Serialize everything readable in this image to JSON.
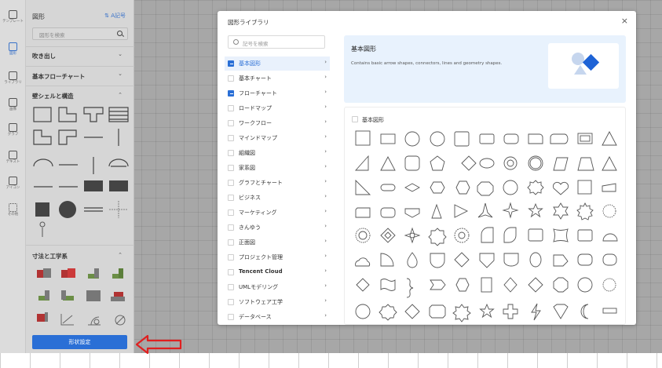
{
  "rail": {
    "items": [
      {
        "label": "テンプレート",
        "icon": "template-icon"
      },
      {
        "label": "図形",
        "icon": "shape-icon"
      },
      {
        "label": "ライブラリ",
        "icon": "library-icon"
      },
      {
        "label": "画像",
        "icon": "image-icon"
      },
      {
        "label": "グラフ",
        "icon": "chart-icon"
      },
      {
        "label": "テキスト",
        "icon": "text-icon"
      },
      {
        "label": "アイコン",
        "icon": "icon-icon"
      },
      {
        "label": "その他",
        "icon": "more-icon"
      }
    ]
  },
  "panel": {
    "title": "図形",
    "link": "⇅ A記号",
    "search_placeholder": "図形を検索",
    "sections": {
      "s1": "吹き出し",
      "s2": "基本フローチャート",
      "s3": "壁シェルと構造",
      "s4": "寸法と工学系"
    },
    "button": "形状設定"
  },
  "dialog": {
    "title": "図形ライブラリ",
    "close": "×",
    "search_placeholder": "記号を検索",
    "categories": [
      {
        "label": "基本図形",
        "checked": true,
        "active": true
      },
      {
        "label": "基本チャート",
        "checked": false
      },
      {
        "label": "フローチャート",
        "checked": true
      },
      {
        "label": "ロードマップ",
        "checked": false
      },
      {
        "label": "ワークフロー",
        "checked": false
      },
      {
        "label": "マインドマップ",
        "checked": false
      },
      {
        "label": "組織図",
        "checked": false
      },
      {
        "label": "家系図",
        "checked": false
      },
      {
        "label": "グラフとチャート",
        "checked": false
      },
      {
        "label": "ビジネス",
        "checked": false
      },
      {
        "label": "マーケティング",
        "checked": false
      },
      {
        "label": "きんゆう",
        "checked": false
      },
      {
        "label": "正面図",
        "checked": false
      },
      {
        "label": "プロジェクト管理",
        "checked": false
      },
      {
        "label": "Tencent Cloud",
        "checked": false
      },
      {
        "label": "UMLモデリング",
        "checked": false
      },
      {
        "label": "ソフトウェア工学",
        "checked": false
      },
      {
        "label": "データベース",
        "checked": false
      }
    ],
    "banner": {
      "title": "基本図形",
      "desc": "Contains basic arrow shapes, connectors, lines and geometry shapes."
    },
    "shapes_header": "基本図形"
  },
  "colors": {
    "accent": "#2a6fd6",
    "arrow": "#e02020"
  }
}
